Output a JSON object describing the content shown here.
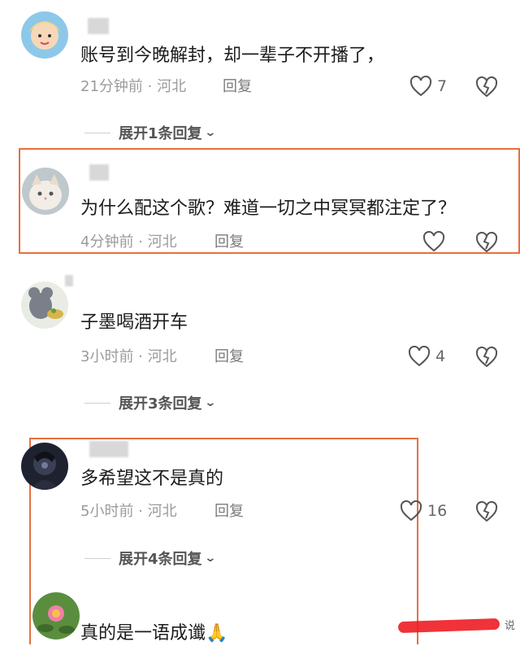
{
  "comments": [
    {
      "text": "账号到今晚解封，却一辈子不开播了，",
      "time": "21分钟前",
      "location": "河北",
      "reply": "回复",
      "likes": "7",
      "expand": "展开1条回复"
    },
    {
      "text": "为什么配这个歌？难道一切之中冥冥都注定了？",
      "time": "4分钟前",
      "location": "河北",
      "reply": "回复",
      "likes": "",
      "expand": ""
    },
    {
      "text": "子墨喝酒开车",
      "time": "3小时前",
      "location": "河北",
      "reply": "回复",
      "likes": "4",
      "expand": "展开3条回复"
    },
    {
      "text": "多希望这不是真的",
      "time": "5小时前",
      "location": "河北",
      "reply": "回复",
      "likes": "16",
      "expand": "展开4条回复"
    },
    {
      "text": "真的是一语成谶🙏",
      "time": "",
      "location": "",
      "reply": "",
      "likes": "",
      "expand": ""
    }
  ],
  "separator": " · ",
  "watermark": "说",
  "colors": {
    "highlight": "#e6703f",
    "meta": "#9b9b9b",
    "text": "#1c1c1c"
  },
  "icons": [
    "heart-outline-icon",
    "broken-heart-icon",
    "chevron-down-icon"
  ]
}
